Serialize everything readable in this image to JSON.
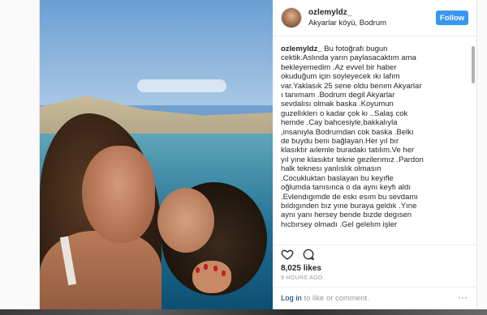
{
  "post": {
    "username": "ozlemyldz_",
    "location": "Akyarlar köyü, Bodrum",
    "follow_label": "Follow",
    "caption_username": "ozlemyldz_",
    "caption_lines": [
      " Bu fotoğrafı bugun",
      "cektik.Aslında yarın paylasacaktım ama",
      "bekleyemedim .Az evvel bir haber",
      "okuduğum için soyleyecek ıkı lafım",
      "var.Yaklasık 25 sene oldu benım Akyarlar",
      "ı tanımam .Bodrum degil Akyarlar",
      "sevdalısı olmak baska .Koyumun",
      "guzellıklerı o kadar çok kı ..Salaş cok",
      "hemde .Cay bahcesiyle,bakkalıyla",
      ",insanıyla Bodrumdan cok baska .Belkı",
      "de buydu benı bağlayan.Her yıl bır",
      "klasıktır aılemle buradakı tatılım.Ve her",
      "yıl yıne klasıktır tekne gezilerımız .Pardon",
      "halk teknesı yanlıslık olmasın",
      ".Cocukluktan baslayan bu keyıfle",
      "oğlumda tanısınca o da aynı keyfı aldı",
      ".Evlendıgımde de eskı esım bu sevdamı",
      "bıldıgınden bız yıne buraya geldık .Yıne",
      "aynı yanı hersey bende bızde degısen",
      "hıcbırsey olmadı .Gel gelelım işler"
    ],
    "likes": "8,025 likes",
    "time": "9 HOURS AGO",
    "login_link": "Log in",
    "login_rest": " to like or comment.",
    "more_label": "···"
  },
  "icons": {
    "like": "heart-icon",
    "comment": "comment-icon",
    "more": "more-options-icon"
  },
  "colors": {
    "follow_button": "#3897f0",
    "link": "#003569"
  }
}
